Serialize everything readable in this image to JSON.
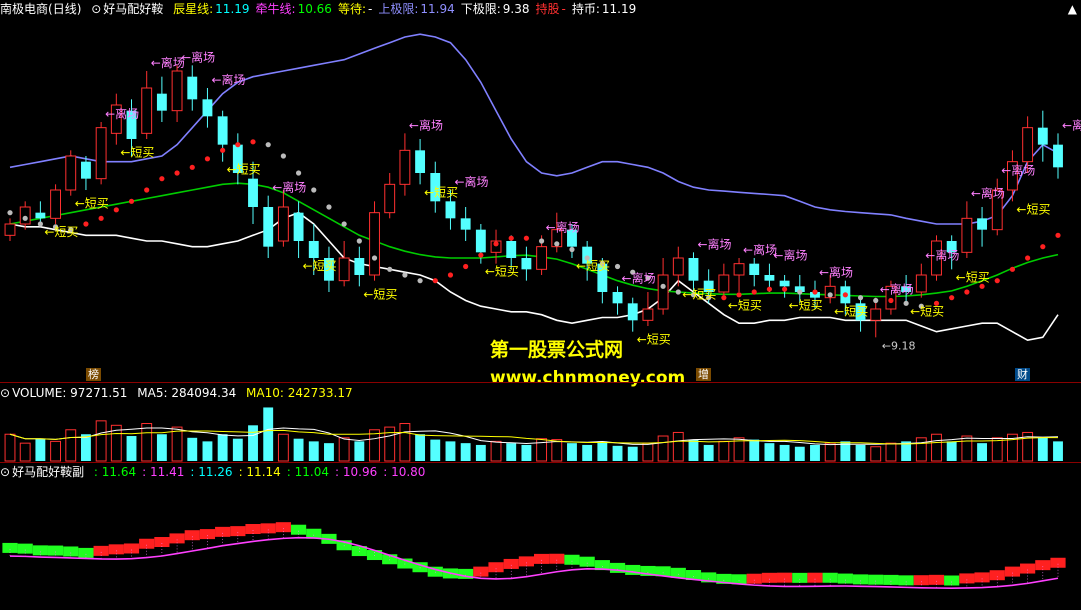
{
  "main": {
    "stock_label": "南极电商",
    "period": "(日线)",
    "indicator": "好马配好鞍",
    "fields": [
      {
        "label": "辰星线:",
        "value": "11.19",
        "label_color": "#ffff00",
        "value_color": "#00ffff"
      },
      {
        "label": "牵牛线:",
        "value": "10.66",
        "label_color": "#ff40ff",
        "value_color": "#00ff00"
      },
      {
        "label": "等待:",
        "value": "-",
        "label_color": "#ffff00",
        "value_color": "#ffffff"
      },
      {
        "label": "上极限:",
        "value": "11.94",
        "label_color": "#8f8fff",
        "value_color": "#8f8fff"
      },
      {
        "label": "下极限:",
        "value": "9.38",
        "label_color": "#ffffff",
        "value_color": "#ffffff"
      },
      {
        "label": "持股",
        "value": "-",
        "label_color": "#ff3030",
        "value_color": "#ff3030"
      },
      {
        "label": "持币:",
        "value": "11.19",
        "label_color": "#ffffff",
        "value_color": "#ffffff"
      }
    ],
    "low_marker": "9.18",
    "signal_exit": "←离场",
    "signal_buy": "←短买",
    "badges": [
      "榜",
      "增",
      "财"
    ]
  },
  "volume": {
    "title": "VOLUME: 97271.51",
    "ma5": "MA5: 284094.34",
    "ma10": "MA10: 242733.17"
  },
  "sub": {
    "title": "好马配好鞍副",
    "values": [
      {
        "text": ": 11.64",
        "color": "#00ff00"
      },
      {
        "text": ": 11.41",
        "color": "#ff40ff"
      },
      {
        "text": ": 11.26",
        "color": "#00ffff"
      },
      {
        "text": ": 11.14",
        "color": "#ffff00"
      },
      {
        "text": ": 11.04",
        "color": "#00ff00"
      },
      {
        "text": ": 10.96",
        "color": "#ff40ff"
      },
      {
        "text": ": 10.80",
        "color": "#ff40ff"
      }
    ]
  },
  "watermark": {
    "line1": "第一股票公式网",
    "line2": "www.chnmoney.com"
  },
  "chart_data": {
    "type": "candlestick",
    "price_ylim": [
      8.8,
      14.8
    ],
    "upper_band": [
      12.2,
      12.25,
      12.3,
      12.35,
      12.4,
      12.35,
      12.3,
      12.3,
      12.3,
      12.35,
      12.4,
      12.6,
      12.9,
      13.2,
      13.5,
      13.7,
      13.8,
      13.85,
      13.9,
      13.95,
      14.0,
      14.05,
      14.1,
      14.2,
      14.3,
      14.4,
      14.5,
      14.55,
      14.5,
      14.4,
      14.1,
      13.7,
      13.2,
      12.7,
      12.3,
      12.1,
      12.05,
      12.1,
      12.2,
      12.3,
      12.3,
      12.25,
      12.2,
      12.1,
      11.95,
      11.85,
      11.8,
      11.78,
      11.76,
      11.74,
      11.72,
      11.7,
      11.6,
      11.5,
      11.45,
      11.42,
      11.4,
      11.38,
      11.36,
      11.3,
      11.25,
      11.2,
      11.2,
      11.2,
      11.25,
      11.35,
      11.7,
      12.3,
      12.6,
      12.45
    ],
    "lower_band": [
      11.2,
      11.15,
      11.15,
      11.1,
      11.05,
      11.0,
      11.0,
      11.0,
      10.95,
      10.9,
      10.9,
      10.85,
      10.8,
      10.8,
      10.85,
      10.9,
      11.0,
      11.1,
      11.3,
      11.4,
      11.2,
      10.9,
      10.6,
      10.5,
      10.45,
      10.4,
      10.35,
      10.3,
      10.2,
      10.0,
      9.85,
      9.75,
      9.7,
      9.65,
      9.65,
      9.6,
      9.5,
      9.45,
      9.5,
      9.55,
      9.55,
      9.6,
      9.7,
      9.9,
      10.2,
      10.0,
      9.8,
      9.6,
      9.45,
      9.45,
      9.5,
      9.5,
      9.55,
      9.55,
      9.55,
      9.5,
      9.5,
      9.5,
      9.5,
      9.5,
      9.4,
      9.3,
      9.35,
      9.4,
      9.45,
      9.45,
      9.3,
      9.15,
      9.2,
      9.6
    ],
    "star_line": [
      11.4,
      11.3,
      11.2,
      11.15,
      11.1,
      11.2,
      11.3,
      11.45,
      11.6,
      11.8,
      12.0,
      12.1,
      12.2,
      12.35,
      12.5,
      12.6,
      12.65,
      12.6,
      12.4,
      12.1,
      11.8,
      11.5,
      11.2,
      10.9,
      10.6,
      10.4,
      10.3,
      10.2,
      10.2,
      10.3,
      10.45,
      10.65,
      10.85,
      10.95,
      10.95,
      10.9,
      10.85,
      10.75,
      10.6,
      10.5,
      10.45,
      10.35,
      10.25,
      10.1,
      10.0,
      9.95,
      9.9,
      9.9,
      9.95,
      10.0,
      10.05,
      10.05,
      10.0,
      10.0,
      9.95,
      9.95,
      9.9,
      9.85,
      9.85,
      9.8,
      9.75,
      9.8,
      9.9,
      10.0,
      10.1,
      10.2,
      10.4,
      10.6,
      10.8,
      11.0
    ],
    "cow_line": [
      11.2,
      11.25,
      11.3,
      11.35,
      11.4,
      11.45,
      11.5,
      11.55,
      11.6,
      11.65,
      11.7,
      11.75,
      11.8,
      11.85,
      11.9,
      11.92,
      11.9,
      11.85,
      11.75,
      11.6,
      11.45,
      11.3,
      11.15,
      11.0,
      10.9,
      10.8,
      10.72,
      10.66,
      10.62,
      10.6,
      10.6,
      10.6,
      10.62,
      10.64,
      10.65,
      10.62,
      10.58,
      10.5,
      10.4,
      10.3,
      10.2,
      10.12,
      10.06,
      10.02,
      10.0,
      9.98,
      9.97,
      9.96,
      9.96,
      9.97,
      9.98,
      9.98,
      9.97,
      9.96,
      9.95,
      9.94,
      9.93,
      9.92,
      9.92,
      9.93,
      9.95,
      9.98,
      10.02,
      10.1,
      10.2,
      10.3,
      10.42,
      10.52,
      10.6,
      10.66
    ],
    "candles": [
      [
        11.0,
        11.2,
        11.3,
        10.9
      ],
      [
        11.2,
        11.5,
        11.6,
        11.1
      ],
      [
        11.4,
        11.3,
        11.6,
        11.2
      ],
      [
        11.3,
        11.8,
        11.9,
        11.2
      ],
      [
        11.8,
        12.4,
        12.5,
        11.7
      ],
      [
        12.3,
        12.0,
        12.4,
        11.8
      ],
      [
        12.0,
        12.9,
        13.0,
        11.9
      ],
      [
        12.8,
        13.3,
        13.5,
        12.6
      ],
      [
        13.2,
        12.7,
        13.4,
        12.4
      ],
      [
        12.8,
        13.6,
        13.9,
        12.7
      ],
      [
        13.5,
        13.2,
        13.8,
        13.0
      ],
      [
        13.2,
        13.9,
        14.0,
        13.0
      ],
      [
        13.8,
        13.4,
        14.0,
        13.2
      ],
      [
        13.4,
        13.1,
        13.6,
        12.9
      ],
      [
        13.1,
        12.6,
        13.2,
        12.3
      ],
      [
        12.6,
        12.1,
        12.8,
        11.9
      ],
      [
        12.0,
        11.5,
        12.3,
        11.2
      ],
      [
        11.5,
        10.8,
        11.7,
        10.6
      ],
      [
        10.9,
        11.5,
        11.8,
        10.8
      ],
      [
        11.4,
        10.9,
        11.6,
        10.6
      ],
      [
        10.9,
        10.6,
        11.2,
        10.3
      ],
      [
        10.6,
        10.2,
        10.8,
        10.0
      ],
      [
        10.2,
        10.6,
        10.9,
        10.1
      ],
      [
        10.6,
        10.3,
        10.8,
        10.1
      ],
      [
        10.3,
        11.4,
        11.6,
        10.2
      ],
      [
        11.4,
        11.9,
        12.1,
        11.3
      ],
      [
        11.9,
        12.5,
        12.8,
        11.7
      ],
      [
        12.5,
        12.1,
        12.7,
        11.9
      ],
      [
        12.1,
        11.6,
        12.3,
        11.4
      ],
      [
        11.6,
        11.3,
        11.8,
        11.1
      ],
      [
        11.3,
        11.1,
        11.5,
        10.9
      ],
      [
        11.1,
        10.7,
        11.2,
        10.5
      ],
      [
        10.7,
        10.9,
        11.1,
        10.5
      ],
      [
        10.9,
        10.6,
        11.0,
        10.4
      ],
      [
        10.6,
        10.4,
        10.8,
        10.2
      ],
      [
        10.4,
        10.8,
        11.0,
        10.3
      ],
      [
        10.8,
        11.1,
        11.4,
        10.7
      ],
      [
        11.1,
        10.8,
        11.2,
        10.6
      ],
      [
        10.8,
        10.5,
        10.9,
        10.2
      ],
      [
        10.5,
        10.0,
        10.6,
        9.8
      ],
      [
        10.0,
        9.8,
        10.1,
        9.6
      ],
      [
        9.8,
        9.5,
        9.9,
        9.3
      ],
      [
        9.5,
        9.7,
        10.0,
        9.4
      ],
      [
        9.7,
        10.3,
        10.6,
        9.6
      ],
      [
        10.3,
        10.6,
        10.8,
        10.1
      ],
      [
        10.6,
        10.2,
        10.7,
        10.0
      ],
      [
        10.2,
        10.0,
        10.4,
        9.8
      ],
      [
        10.0,
        10.3,
        10.5,
        9.9
      ],
      [
        10.3,
        10.5,
        10.6,
        10.0
      ],
      [
        10.5,
        10.3,
        10.6,
        10.1
      ],
      [
        10.3,
        10.2,
        10.5,
        10.0
      ],
      [
        10.2,
        10.1,
        10.3,
        9.9
      ],
      [
        10.1,
        10.0,
        10.3,
        9.8
      ],
      [
        10.0,
        9.9,
        10.2,
        9.7
      ],
      [
        9.9,
        10.1,
        10.3,
        9.8
      ],
      [
        10.1,
        9.8,
        10.2,
        9.6
      ],
      [
        9.8,
        9.5,
        9.9,
        9.3
      ],
      [
        9.5,
        9.7,
        9.9,
        9.2
      ],
      [
        9.7,
        10.1,
        10.2,
        9.6
      ],
      [
        10.1,
        10.0,
        10.3,
        9.8
      ],
      [
        10.0,
        10.3,
        10.5,
        9.9
      ],
      [
        10.3,
        10.9,
        11.0,
        10.2
      ],
      [
        10.9,
        10.7,
        11.0,
        10.4
      ],
      [
        10.7,
        11.3,
        11.6,
        10.6
      ],
      [
        11.3,
        11.1,
        11.5,
        10.8
      ],
      [
        11.1,
        11.8,
        12.0,
        11.0
      ],
      [
        11.8,
        12.3,
        12.5,
        11.6
      ],
      [
        12.3,
        12.9,
        13.1,
        12.1
      ],
      [
        12.9,
        12.6,
        13.2,
        12.3
      ],
      [
        12.6,
        12.2,
        12.8,
        12.0
      ]
    ]
  }
}
